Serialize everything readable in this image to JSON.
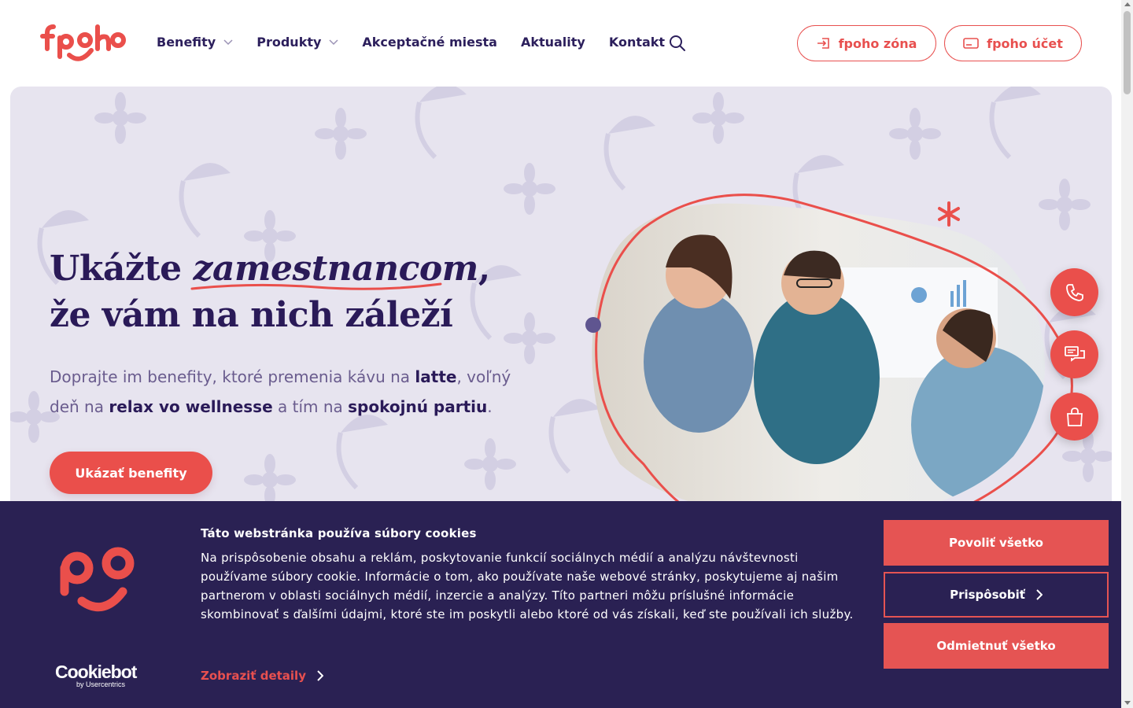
{
  "brand": {
    "name": "fpoho",
    "accent": "#ea4f4b",
    "navy": "#2a1a58",
    "hero_bg": "#e7e4ef",
    "cookie_bg": "#2a2153"
  },
  "header": {
    "nav": [
      {
        "label": "Benefity",
        "has_dropdown": true
      },
      {
        "label": "Produkty",
        "has_dropdown": true
      },
      {
        "label": "Akceptačné miesta",
        "has_dropdown": false
      },
      {
        "label": "Aktuality",
        "has_dropdown": false
      },
      {
        "label": "Kontakt",
        "has_dropdown": false
      }
    ],
    "search_icon": "search-icon",
    "zona_label": "fpoho zóna",
    "ucet_label": "fpoho účet"
  },
  "hero": {
    "title_part1": "Ukážte ",
    "title_emphasis": "zamestnancom",
    "title_part2": ", že vám na nich záleží",
    "subtitle_1": "Doprajte im benefity, ktoré premenia kávu na ",
    "subtitle_b1": "latte",
    "subtitle_2": ", voľný deň na ",
    "subtitle_b2": "relax vo wellnesse",
    "subtitle_3": " a tím na ",
    "subtitle_b3": "spokojnú partiu",
    "subtitle_4": ".",
    "cta_label": "Ukázať benefity"
  },
  "side_actions": [
    {
      "icon": "phone-icon"
    },
    {
      "icon": "chat-icon"
    },
    {
      "icon": "shopping-bag-icon"
    }
  ],
  "cookie": {
    "title": "Táto webstránka používa súbory cookies",
    "text": "Na prispôsobenie obsahu a reklám, poskytovanie funkcií sociálnych médií a analýzu návštevnosti používame súbory cookie. Informácie o tom, ako používate naše webové stránky, poskytujeme aj našim partnerom v oblasti sociálnych médií, inzercie a analýzy. Títo partneri môžu príslušné informácie skombinovať s ďalšími údajmi, ktoré ste im poskytli alebo ktoré od vás získali, keď ste používali ich služby.",
    "details_label": "Zobraziť detaily",
    "allow_label": "Povoliť všetko",
    "customize_label": "Prispôsobiť",
    "deny_label": "Odmietnuť všetko",
    "provider_name": "Cookiebot",
    "provider_by": "by Usercentrics"
  }
}
